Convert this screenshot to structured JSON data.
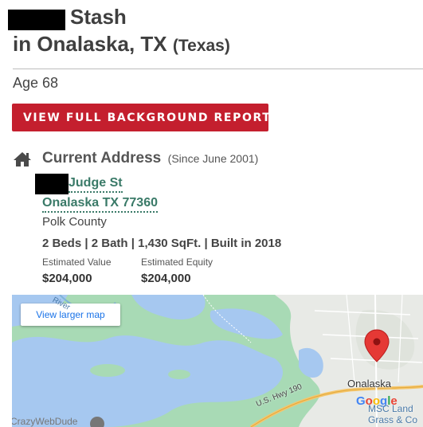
{
  "person": {
    "name_suffix": "Stash",
    "location_prefix": "in Onalaska, TX",
    "state_full": "(Texas)",
    "age": "Age 68"
  },
  "report_button": {
    "label": "VIEW FULL BACKGROUND REPORT",
    "chevron": "»"
  },
  "address": {
    "heading": "Current Address",
    "since": "(Since June 2001)",
    "street": "Judge St",
    "city_line": "Onalaska TX 77360",
    "county": "Polk County",
    "specs": "2 Beds | 2 Bath | 1,430 SqFt. | Built in 2018",
    "estimated_value_label": "Estimated Value",
    "estimated_value": "$204,000",
    "estimated_equity_label": "Estimated Equity",
    "estimated_equity": "$204,000"
  },
  "map": {
    "larger_map_link": "View larger map",
    "town_label": "Onalaska",
    "highway_label": "U.S. Hwy 190",
    "poi_label_line1": "MSC Land",
    "poi_label_line2": "Grass & Co",
    "google_logo": "Google",
    "river_label": "River",
    "watermark": "CrazyWebDude",
    "pin_icon": "map-pin-icon",
    "colors": {
      "water": "#a6c8f0",
      "land": "#a8dab5",
      "urban": "#e8eae6",
      "pin": "#e53935"
    }
  },
  "colors": {
    "accent_red": "#c41f2e",
    "link_green": "#3a7a68"
  }
}
